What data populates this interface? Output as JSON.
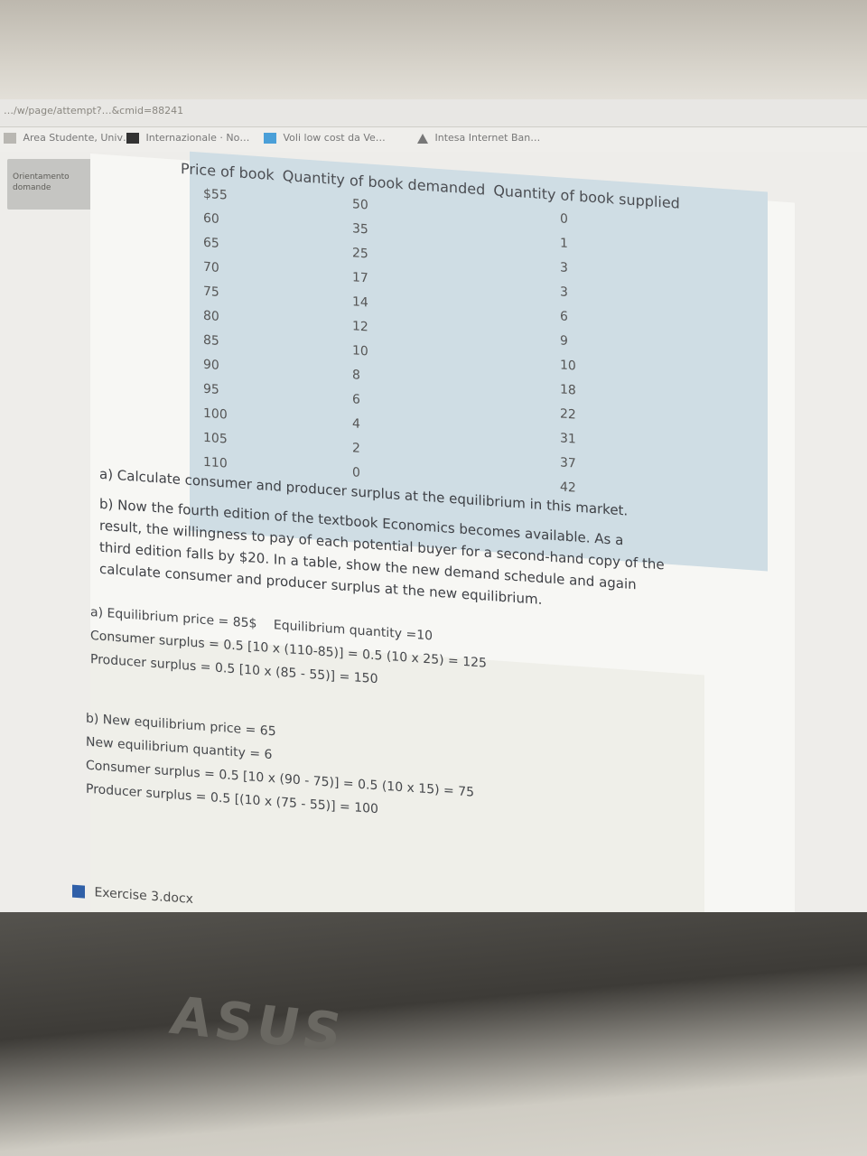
{
  "browser": {
    "url_fragment": "…/w/page/attempt?…&cmid=88241",
    "bookmarks": [
      "Area Studente, Univ…",
      "Internazionale · No…",
      "Voli low cost da Ve…",
      "Intesa Internet Ban…"
    ]
  },
  "sidebar": {
    "label": "Orientamento domande"
  },
  "table": {
    "headers": [
      "Price of book",
      "Quantity of book demanded",
      "Quantity of book supplied"
    ],
    "prices": [
      "$55",
      "60",
      "65",
      "70",
      "75",
      "80",
      "85",
      "90",
      "95",
      "100",
      "105",
      "110"
    ],
    "demanded": [
      "50",
      "35",
      "25",
      "17",
      "14",
      "12",
      "10",
      "8",
      "6",
      "4",
      "2",
      "0"
    ],
    "supplied": [
      "0",
      "1",
      "3",
      "3",
      "6",
      "9",
      "10",
      "18",
      "22",
      "31",
      "37",
      "42"
    ]
  },
  "question": {
    "a": "a) Calculate consumer and producer surplus at the equilibrium in this market.",
    "b_lines": [
      "b) Now the fourth edition of the textbook Economics becomes available. As a",
      "result, the willingness to pay of each potential buyer for a second-hand copy of the",
      "third edition falls by $20. In a table, show the new demand schedule and again",
      "calculate consumer and producer surplus at the new equilibrium."
    ]
  },
  "answer": {
    "a_price": "a) Equilibrium price = 85$",
    "a_quantity": "Equilibrium quantity =10",
    "a_cs": "Consumer surplus = 0.5 [10 x (110-85)] = 0.5 (10 x 25) = 125",
    "a_ps": "Producer surplus = 0.5 [10 x (85 - 55)] = 150",
    "b_price": "b) New equilibrium price = 65",
    "b_quantity": "New equilibrium quantity = 6",
    "b_cs": "Consumer surplus = 0.5 [10 x (90 - 75)] = 0.5 (10 x 15) = 75",
    "b_ps": "Producer surplus = 0.5 [(10 x (75 - 55)] = 100"
  },
  "attachment": {
    "filename": "Exercise 3.docx"
  },
  "laptop": {
    "brand": "ASUS"
  },
  "colors": {
    "table_bg": "#cfdde4",
    "answer_bg": "#efefe9",
    "page_bg": "#f7f7f4"
  }
}
